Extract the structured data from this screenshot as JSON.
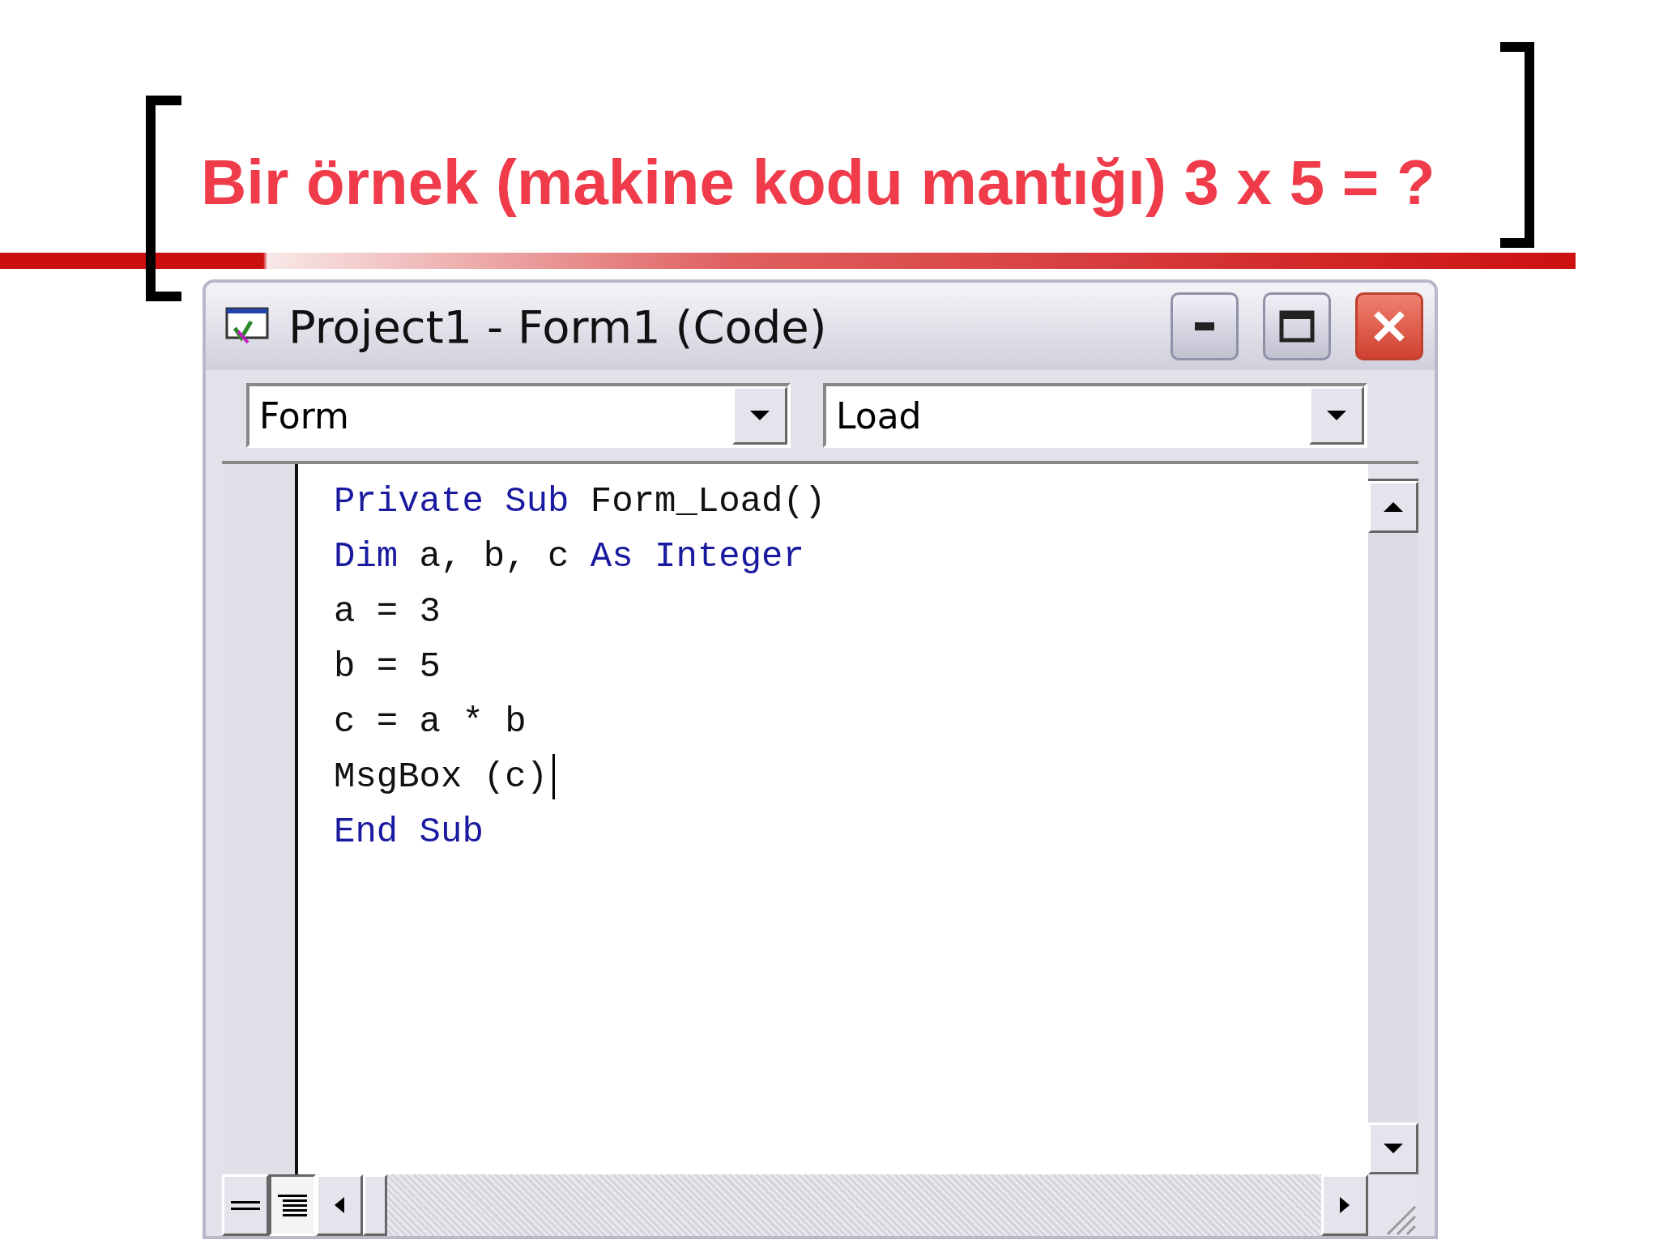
{
  "slide_title": "Bir örnek (makine kodu mantığı) 3 x 5 = ?",
  "window": {
    "title": "Project1 - Form1 (Code)"
  },
  "object_combo": {
    "value": "Form"
  },
  "procedure_combo": {
    "value": "Load"
  },
  "code_lines": [
    {
      "caret": false,
      "tokens": [
        {
          "kind": "keyword",
          "text": "Private Sub"
        },
        {
          "kind": "plain",
          "text": " Form_Load()"
        }
      ]
    },
    {
      "caret": false,
      "tokens": [
        {
          "kind": "keyword",
          "text": "Dim"
        },
        {
          "kind": "plain",
          "text": " a, b, c "
        },
        {
          "kind": "keyword",
          "text": "As Integer"
        }
      ]
    },
    {
      "caret": false,
      "tokens": [
        {
          "kind": "plain",
          "text": "a = 3"
        }
      ]
    },
    {
      "caret": false,
      "tokens": [
        {
          "kind": "plain",
          "text": "b = 5"
        }
      ]
    },
    {
      "caret": false,
      "tokens": [
        {
          "kind": "plain",
          "text": "c = a * b"
        }
      ]
    },
    {
      "caret": true,
      "tokens": [
        {
          "kind": "plain",
          "text": "MsgBox (c)"
        }
      ]
    },
    {
      "caret": false,
      "tokens": [
        {
          "kind": "keyword",
          "text": "End Sub"
        }
      ]
    }
  ],
  "view_buttons": [
    {
      "kind": "procedure",
      "selected": false
    },
    {
      "kind": "module",
      "selected": true
    }
  ]
}
